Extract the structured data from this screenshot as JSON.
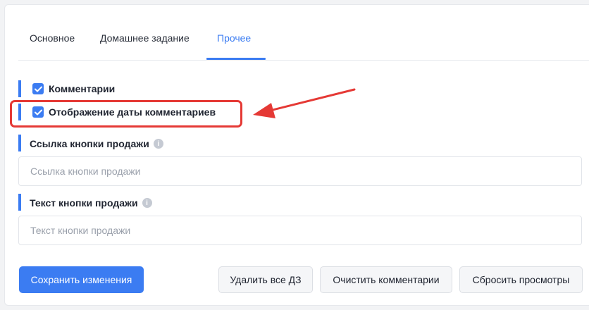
{
  "tabs": [
    {
      "label": "Основное",
      "active": false
    },
    {
      "label": "Домашнее задание",
      "active": false
    },
    {
      "label": "Прочее",
      "active": true
    }
  ],
  "checkboxes": [
    {
      "label": "Комментарии",
      "checked": true
    },
    {
      "label": "Отображение даты комментариев",
      "checked": true
    }
  ],
  "fields": [
    {
      "label": "Ссылка кнопки продажи",
      "placeholder": "Ссылка кнопки продажи",
      "value": ""
    },
    {
      "label": "Текст кнопки продажи",
      "placeholder": "Текст кнопки продажи",
      "value": ""
    }
  ],
  "info_icon_glyph": "i",
  "buttons": {
    "save": "Сохранить изменения",
    "delete_hw": "Удалить все ДЗ",
    "clear_comments": "Очистить комментарии",
    "reset_views": "Сбросить просмотры"
  },
  "colors": {
    "accent": "#3b7cf2",
    "annotation": "#e53935"
  }
}
